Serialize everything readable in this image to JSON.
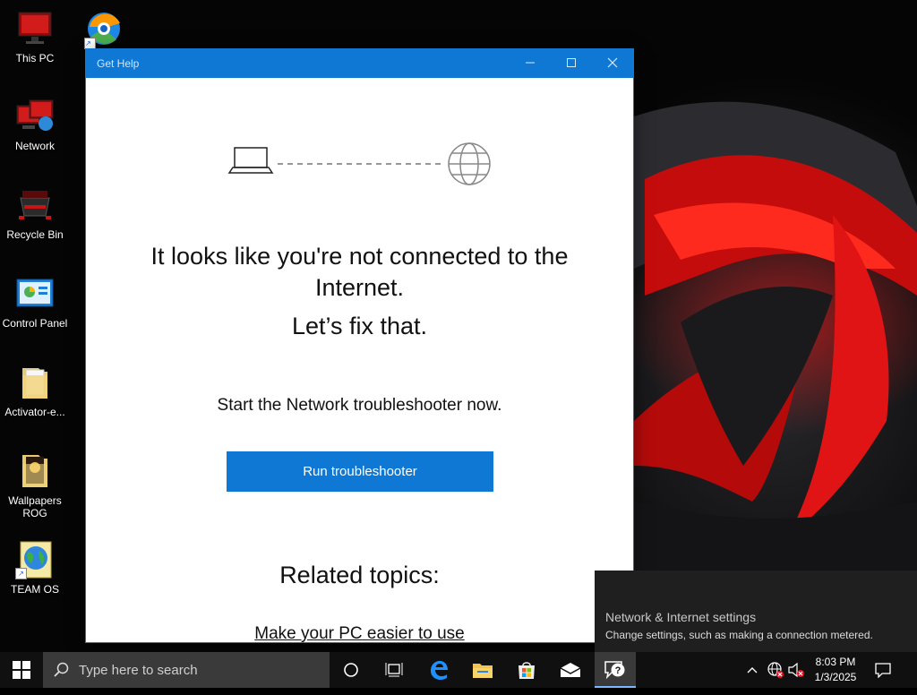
{
  "desktop": {
    "icons": [
      {
        "label": "This PC",
        "icon": "monitor-icon"
      },
      {
        "label": "Network",
        "icon": "network-icon"
      },
      {
        "label": "Recycle Bin",
        "icon": "recycle-bin-icon"
      },
      {
        "label": "Control Panel",
        "icon": "control-panel-icon"
      },
      {
        "label": "Activator-e...",
        "icon": "folder-icon"
      },
      {
        "label": "Wallpapers\nROG",
        "icon": "folder-icon"
      },
      {
        "label": "TEAM OS",
        "icon": "globe-document-icon"
      }
    ]
  },
  "window": {
    "title": "Get Help",
    "headline": "It looks like you're not connected to the Internet.",
    "subline": "Let’s fix that.",
    "prompt": "Start the Network troubleshooter now.",
    "run_button": "Run troubleshooter",
    "related_heading": "Related topics:",
    "related_link": "Make your PC easier to use"
  },
  "flyout": {
    "title": "Network & Internet settings",
    "subtitle": "Change settings, such as making a connection metered."
  },
  "taskbar": {
    "search_placeholder": "Type here to search",
    "time": "8:03 PM",
    "date": "1/3/2025"
  },
  "colors": {
    "accent": "#0f78d4",
    "taskbar": "#101010",
    "flyout": "#1f1f1f"
  }
}
